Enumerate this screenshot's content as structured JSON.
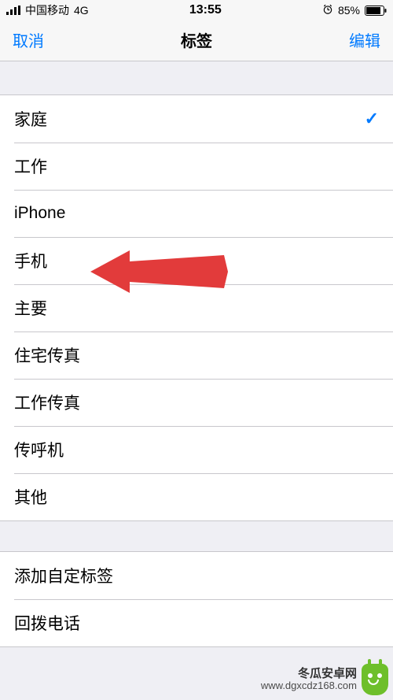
{
  "status": {
    "carrier": "中国移动",
    "network": "4G",
    "time": "13:55",
    "battery_pct": "85%"
  },
  "nav": {
    "left": "取消",
    "title": "标签",
    "right": "编辑"
  },
  "labels": {
    "items": [
      {
        "text": "家庭",
        "selected": true
      },
      {
        "text": "工作",
        "selected": false
      },
      {
        "text": "iPhone",
        "selected": false
      },
      {
        "text": "手机",
        "selected": false
      },
      {
        "text": "主要",
        "selected": false
      },
      {
        "text": "住宅传真",
        "selected": false
      },
      {
        "text": "工作传真",
        "selected": false
      },
      {
        "text": "传呼机",
        "selected": false
      },
      {
        "text": "其他",
        "selected": false
      }
    ]
  },
  "extra": {
    "add_custom": "添加自定标签",
    "callback": "回拨电话"
  },
  "watermark": {
    "cn": "冬瓜安卓网",
    "url": "www.dgxcdz168.com"
  },
  "annotation": {
    "arrow_target": "手机"
  }
}
